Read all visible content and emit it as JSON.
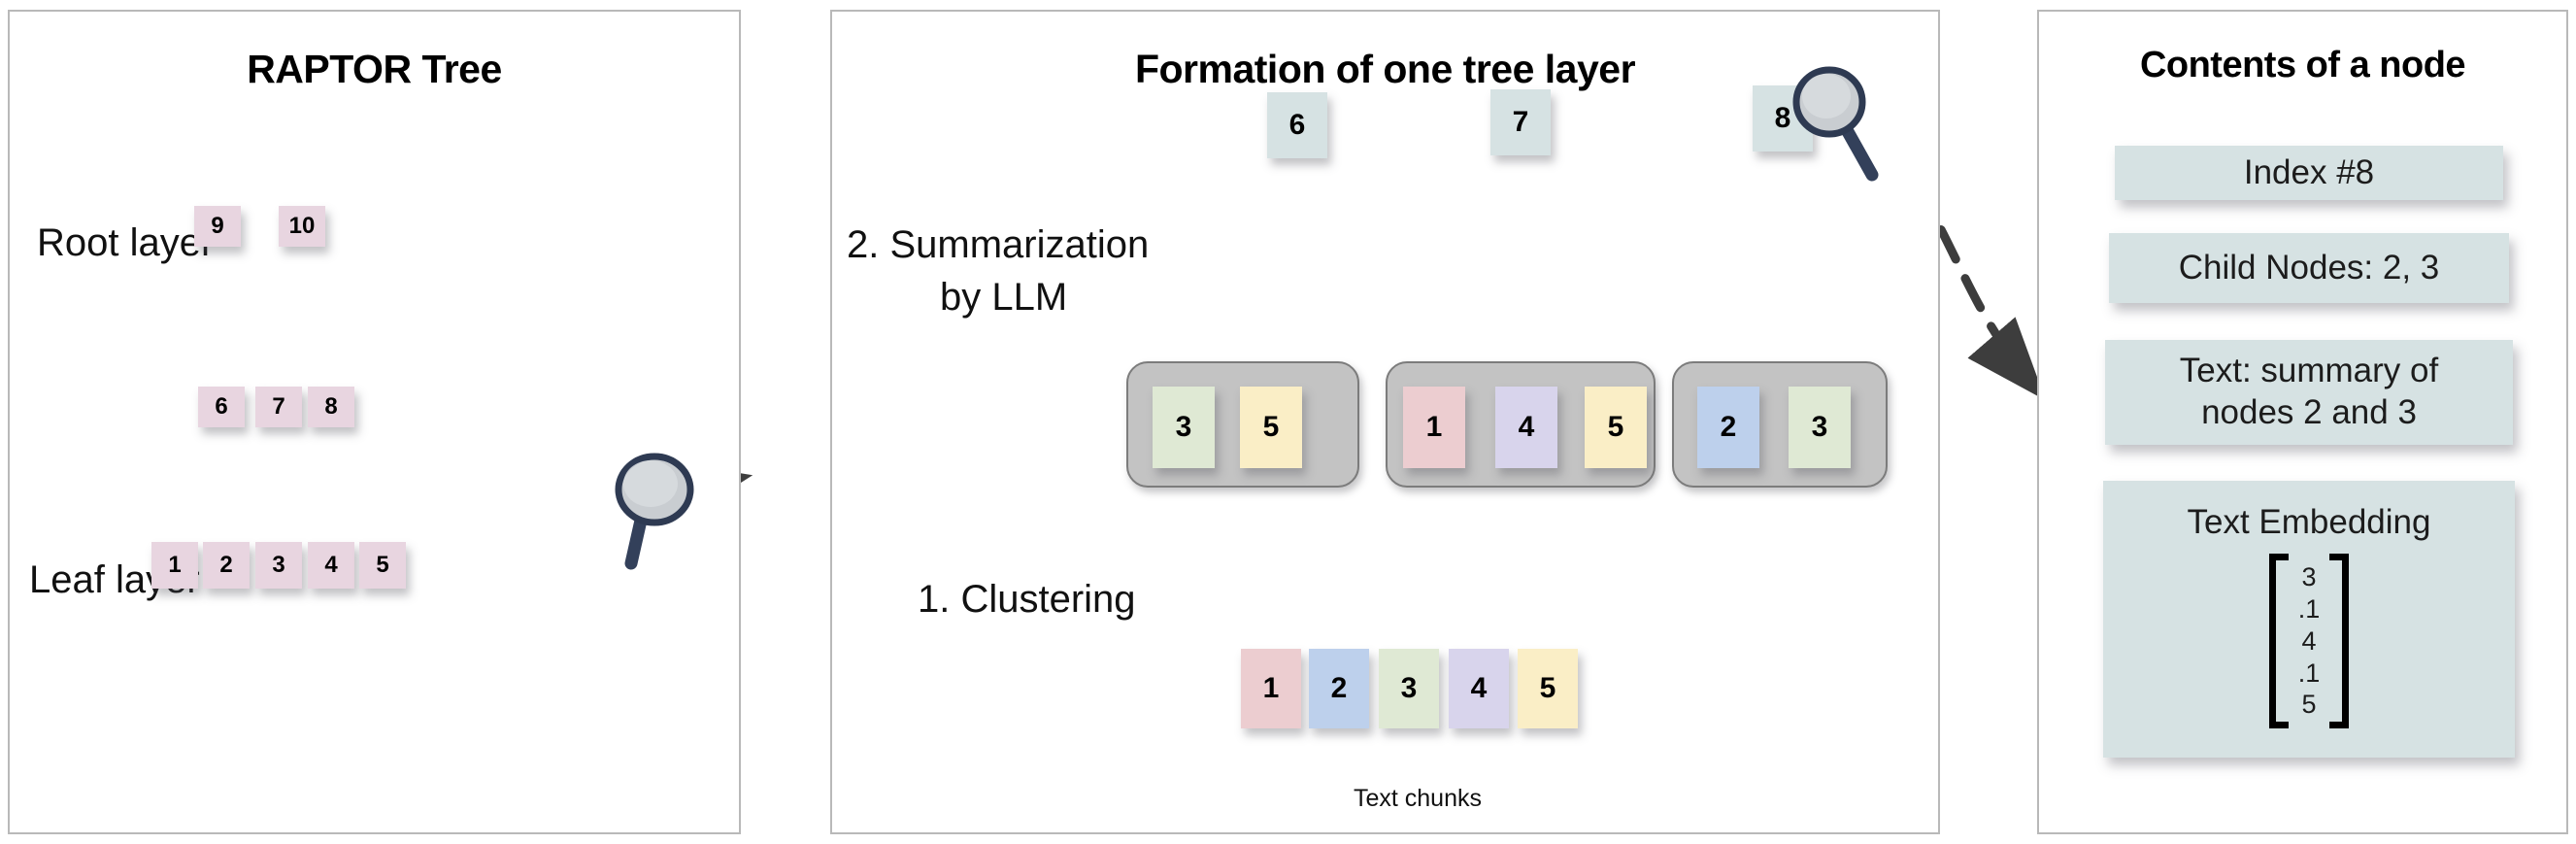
{
  "panels": {
    "left": {
      "title": "RAPTOR Tree",
      "labels": {
        "root": "Root layer",
        "leaf": "Leaf layer"
      },
      "root_nodes": [
        {
          "id": "9",
          "label": "9"
        },
        {
          "id": "10",
          "label": "10"
        }
      ],
      "mid_nodes": [
        {
          "id": "6",
          "label": "6"
        },
        {
          "id": "7",
          "label": "7"
        },
        {
          "id": "8",
          "label": "8"
        }
      ],
      "leaf_nodes": [
        {
          "id": "1",
          "label": "1"
        },
        {
          "id": "2",
          "label": "2"
        },
        {
          "id": "3",
          "label": "3"
        },
        {
          "id": "4",
          "label": "4"
        },
        {
          "id": "5",
          "label": "5"
        }
      ],
      "magnifier": "magnifier-icon"
    },
    "middle": {
      "title": "Formation of one tree layer",
      "step2": "2. Summarization\nby LLM",
      "step2_line1": "2. Summarization",
      "step2_line2": "by LLM",
      "step1": "1. Clustering",
      "chunks_caption": "Text chunks",
      "summary_nodes": [
        {
          "label": "6"
        },
        {
          "label": "7"
        },
        {
          "label": "8"
        }
      ],
      "clusters": [
        {
          "members": [
            {
              "label": "3",
              "color": "c-green"
            },
            {
              "label": "5",
              "color": "c-yellow"
            }
          ]
        },
        {
          "members": [
            {
              "label": "1",
              "color": "c-red"
            },
            {
              "label": "4",
              "color": "c-purple"
            },
            {
              "label": "5",
              "color": "c-yellow"
            }
          ]
        },
        {
          "members": [
            {
              "label": "2",
              "color": "c-blue"
            },
            {
              "label": "3",
              "color": "c-green"
            }
          ]
        }
      ],
      "text_chunks": [
        {
          "label": "1",
          "color": "c-red"
        },
        {
          "label": "2",
          "color": "c-blue"
        },
        {
          "label": "3",
          "color": "c-green"
        },
        {
          "label": "4",
          "color": "c-purple"
        },
        {
          "label": "5",
          "color": "c-yellow"
        }
      ],
      "magnifier": "magnifier-icon"
    },
    "right": {
      "title": "Contents of a node",
      "index_label": "Index #8",
      "child_nodes_label": "Child Nodes: 2, 3",
      "text_line1": "Text:  summary of",
      "text_line2": "nodes 2 and 3",
      "embedding_title": "Text Embedding",
      "embedding_values": [
        "3",
        ".1",
        "4",
        ".1",
        "5"
      ]
    }
  },
  "colors": {
    "pink_node": "#e8d5e0",
    "teal_node": "#d6e2e3",
    "chunk_red": "#eccdd0",
    "chunk_blue": "#bdd0ec",
    "chunk_green": "#dfe9d4",
    "chunk_purple": "#d8d4ec",
    "chunk_yellow": "#faeec6",
    "cluster_box": "#c3c3c3",
    "panel_border": "#b9b9b9",
    "magnifier_handle": "#33405a"
  }
}
